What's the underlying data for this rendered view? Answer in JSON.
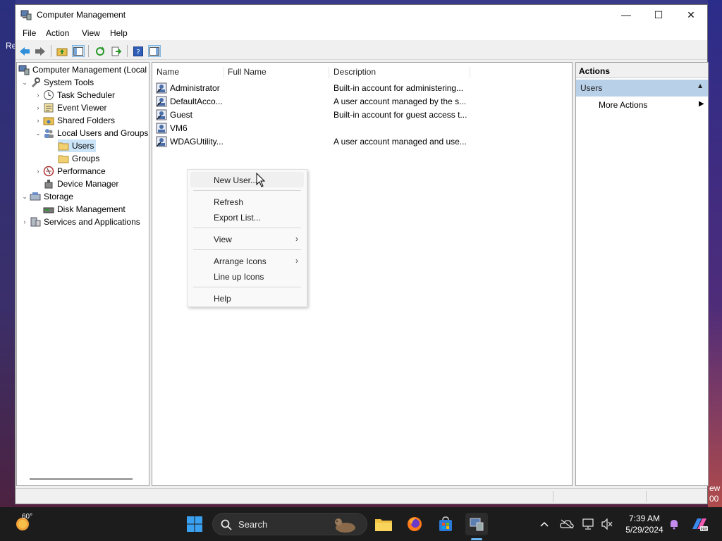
{
  "background": {
    "left_text": "Re",
    "right_text_1": "ew",
    "right_text_2": "00"
  },
  "window": {
    "title": "Computer Management",
    "minimize": "—",
    "maximize": "☐",
    "close": "✕"
  },
  "menu": [
    "File",
    "Action",
    "View",
    "Help"
  ],
  "tree": {
    "root": "Computer Management (Local",
    "system_tools": "System Tools",
    "task_scheduler": "Task Scheduler",
    "event_viewer": "Event Viewer",
    "shared_folders": "Shared Folders",
    "local_users_groups": "Local Users and Groups",
    "users": "Users",
    "groups": "Groups",
    "performance": "Performance",
    "device_manager": "Device Manager",
    "storage": "Storage",
    "disk_management": "Disk Management",
    "services_apps": "Services and Applications"
  },
  "list": {
    "columns": [
      "Name",
      "Full Name",
      "Description"
    ],
    "rows": [
      {
        "name": "Administrator",
        "full_name": "",
        "description": "Built-in account for administering..."
      },
      {
        "name": "DefaultAcco...",
        "full_name": "",
        "description": "A user account managed by the s..."
      },
      {
        "name": "Guest",
        "full_name": "",
        "description": "Built-in account for guest access t..."
      },
      {
        "name": "VM6",
        "full_name": "",
        "description": ""
      },
      {
        "name": "WDAGUtility...",
        "full_name": "",
        "description": "A user account managed and use..."
      }
    ]
  },
  "actions": {
    "header": "Actions",
    "section": "Users",
    "more": "More Actions"
  },
  "context_menu": {
    "new_user": "New User...",
    "refresh": "Refresh",
    "export": "Export List...",
    "view": "View",
    "arrange": "Arrange Icons",
    "lineup": "Line up Icons",
    "help": "Help"
  },
  "taskbar": {
    "temperature": "60°",
    "search": "Search",
    "time": "7:39 AM",
    "date": "5/29/2024"
  },
  "colors": {
    "selection": "#cce4f7",
    "actions_section": "#b8d0e8",
    "taskbar": "#1c1c1c"
  }
}
